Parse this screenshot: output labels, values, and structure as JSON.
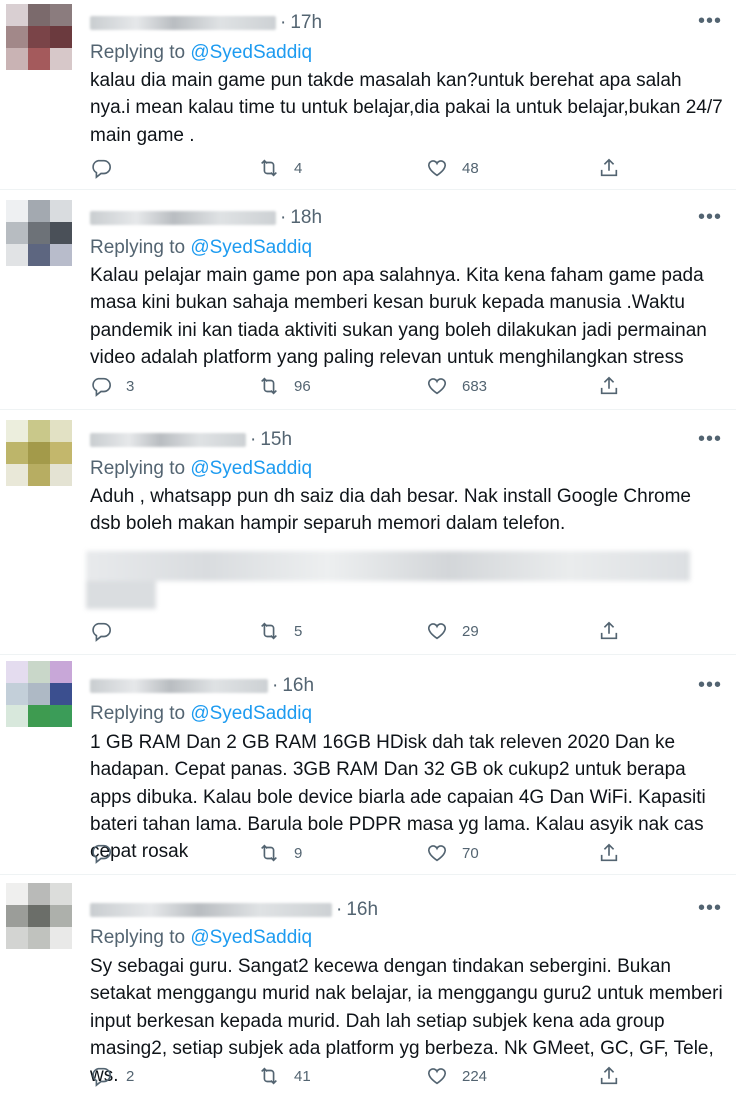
{
  "tweets": [
    {
      "time": "17h",
      "reply_label": "Replying to ",
      "reply_handle": "@SyedSaddiq",
      "text": "kalau dia main game pun takde masalah kan?untuk berehat apa salah nya.i mean kalau time tu untuk belajar,dia pakai la untuk belajar,bukan 24/7 main game .",
      "replies": "",
      "retweets": "4",
      "likes": "48"
    },
    {
      "time": "18h",
      "reply_label": "Replying to ",
      "reply_handle": "@SyedSaddiq",
      "text": "Kalau pelajar main game pon apa salahnya. Kita kena faham game pada masa kini bukan sahaja memberi kesan buruk kepada manusia .Waktu pandemik ini kan tiada aktiviti sukan yang boleh dilakukan jadi permainan video adalah platform yang paling relevan untuk menghilangkan stress",
      "replies": "3",
      "retweets": "96",
      "likes": "683"
    },
    {
      "time": "15h",
      "reply_label": "Replying to ",
      "reply_handle": "@SyedSaddiq",
      "text": "Aduh , whatsapp pun dh saiz dia dah besar. Nak install Google Chrome dsb boleh makan hampir separuh memori dalam telefon.",
      "replies": "",
      "retweets": "5",
      "likes": "29"
    },
    {
      "time": "16h",
      "reply_label": "Replying to ",
      "reply_handle": "@SyedSaddiq",
      "text": "1 GB RAM Dan 2 GB RAM 16GB HDisk dah tak releven 2020 Dan ke hadapan. Cepat panas. 3GB RAM Dan 32 GB ok cukup2 untuk berapa apps dibuka. Kalau bole device biarla ade capaian 4G Dan WiFi. Kapasiti bateri tahan lama. Barula bole PDPR masa yg lama. Kalau asyik nak cas cepat rosak",
      "replies": "",
      "retweets": "9",
      "likes": "70"
    },
    {
      "time": "16h",
      "reply_label": "Replying to ",
      "reply_handle": "@SyedSaddiq",
      "text": "Sy sebagai guru. Sangat2 kecewa dengan tindakan sebergini. Bukan setakat menggangu murid nak belajar, ia menggangu guru2 untuk memberi input berkesan kepada murid. Dah lah setiap subjek kena ada group masing2, setiap subjek ada platform yg berbeza. Nk GMeet, GC, GF, Tele, ws.",
      "replies": "2",
      "retweets": "41",
      "likes": "224"
    }
  ],
  "more_glyph": "•••",
  "icons": {
    "reply": "reply-bubble-icon",
    "retweet": "retweet-icon",
    "like": "heart-icon",
    "share": "share-upload-icon",
    "more": "more-dots-icon"
  },
  "colors": {
    "text": "#0f1419",
    "secondary": "#536471",
    "link": "#1d9bf0",
    "divider": "#eff3f4"
  }
}
